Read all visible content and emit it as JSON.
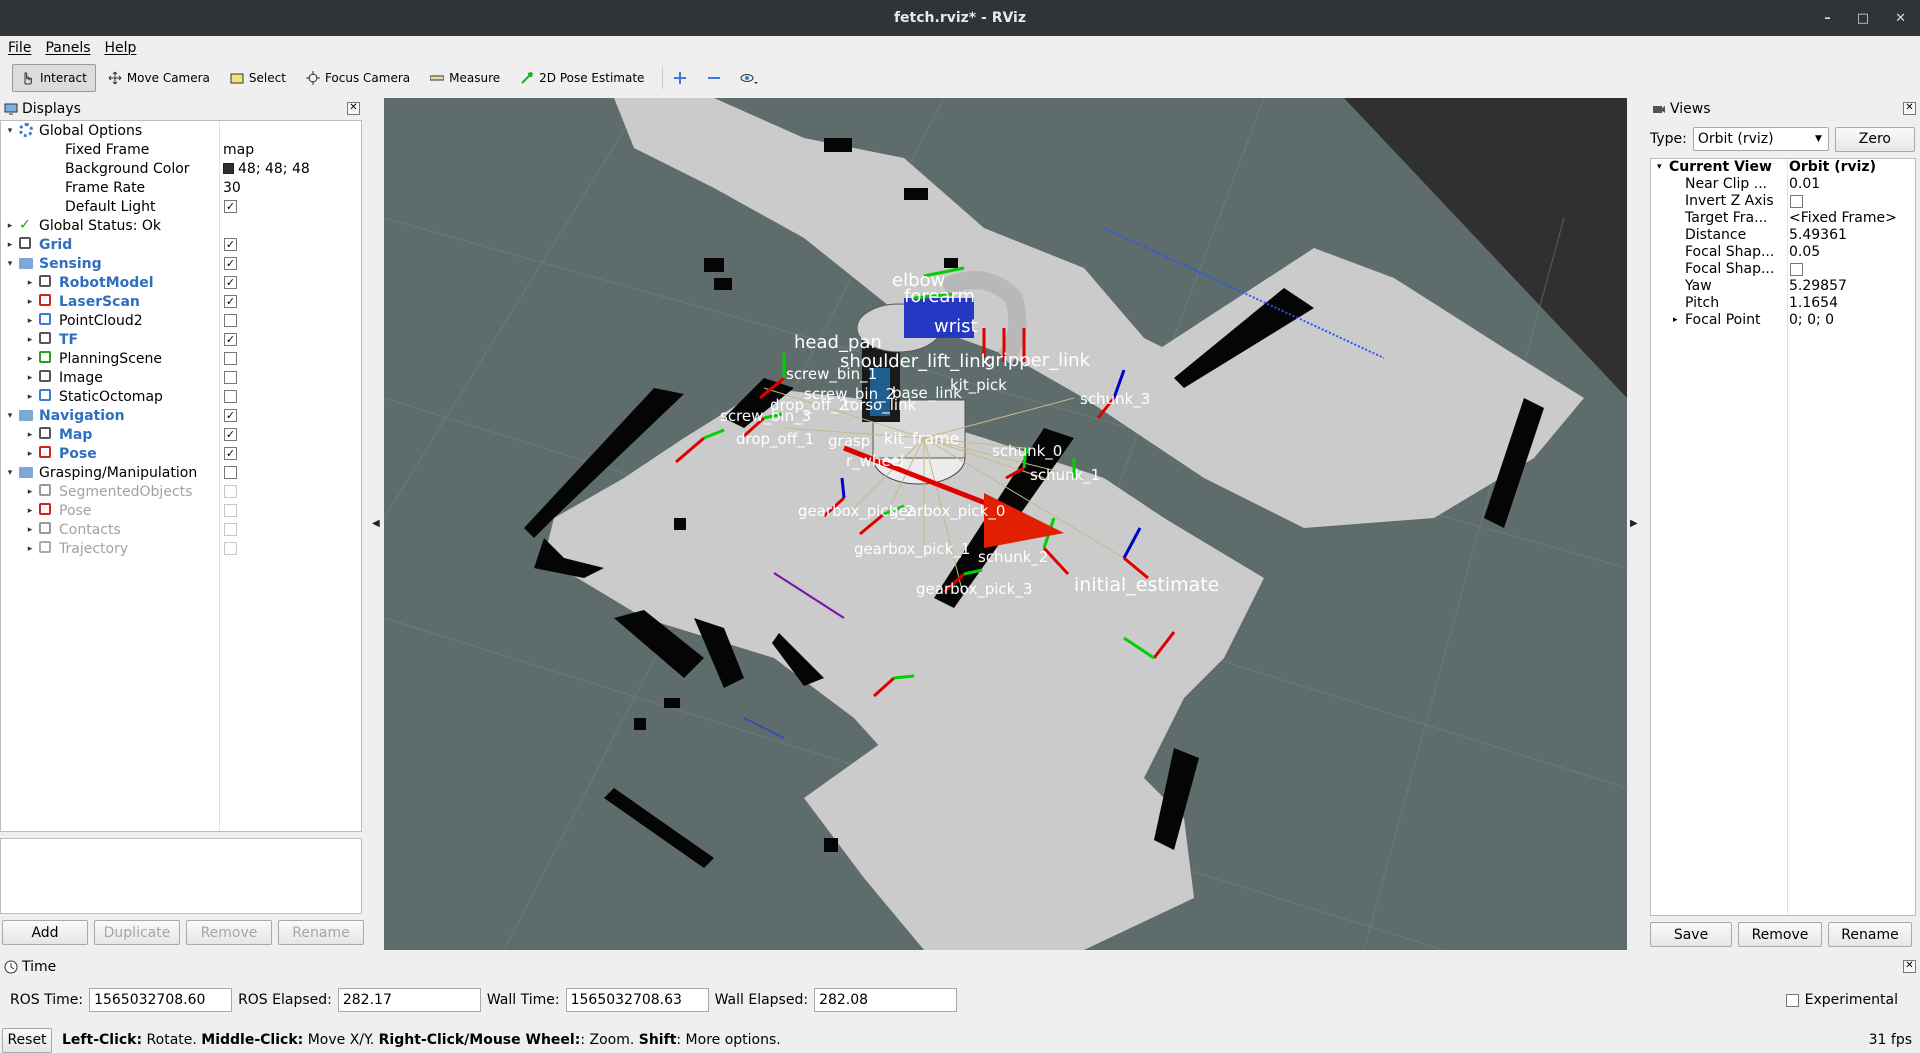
{
  "window": {
    "title": "fetch.rviz* - RViz",
    "controls": [
      "–",
      "□",
      "✕"
    ]
  },
  "menu": [
    "File",
    "Panels",
    "Help"
  ],
  "toolbar": {
    "tools": [
      {
        "label": "Interact",
        "icon": "hand-pointer-icon",
        "active": true
      },
      {
        "label": "Move Camera",
        "icon": "move-camera-icon"
      },
      {
        "label": "Select",
        "icon": "select-box-icon"
      },
      {
        "label": "Focus Camera",
        "icon": "focus-camera-icon"
      },
      {
        "label": "Measure",
        "icon": "ruler-icon"
      },
      {
        "label": "2D Pose Estimate",
        "icon": "pose-estimate-arrow-icon"
      }
    ],
    "extra_icons": [
      "plus-icon",
      "minus-icon",
      "eye-dropdown-icon"
    ]
  },
  "displays": {
    "title": "Displays",
    "rows": [
      {
        "label": "Global Options",
        "level": 0,
        "arrow": "▾",
        "icon": "gear-icon"
      },
      {
        "label": "Fixed Frame",
        "level": 1,
        "value": "map"
      },
      {
        "label": "Background Color",
        "level": 1,
        "value": "48; 48; 48",
        "swatch": "#303030"
      },
      {
        "label": "Frame Rate",
        "level": 1,
        "value": "30"
      },
      {
        "label": "Default Light",
        "level": 1,
        "check": true
      },
      {
        "label": "Global Status: Ok",
        "level": 0,
        "arrow": "▸",
        "icon": "check-icon"
      },
      {
        "label": "Grid",
        "level": 0,
        "arrow": "▸",
        "icon": "grid-icon",
        "blue": true,
        "check": true
      },
      {
        "label": "Sensing",
        "level": 0,
        "arrow": "▾",
        "icon": "folder-icon",
        "blue": true,
        "check": true
      },
      {
        "label": "RobotModel",
        "level": 1,
        "arrow": "▸",
        "icon": "robot-icon",
        "blue": true,
        "check": true
      },
      {
        "label": "LaserScan",
        "level": 1,
        "arrow": "▸",
        "icon": "laser-scan-icon",
        "blue": true,
        "check": true
      },
      {
        "label": "PointCloud2",
        "level": 1,
        "arrow": "▸",
        "icon": "point-cloud-icon",
        "check": false
      },
      {
        "label": "TF",
        "level": 1,
        "arrow": "▸",
        "icon": "tf-axes-icon",
        "blue": true,
        "check": true
      },
      {
        "label": "PlanningScene",
        "level": 1,
        "arrow": "▸",
        "icon": "planning-scene-icon",
        "check": false
      },
      {
        "label": "Image",
        "level": 1,
        "arrow": "▸",
        "icon": "image-icon",
        "check": false
      },
      {
        "label": "StaticOctomap",
        "level": 1,
        "arrow": "▸",
        "icon": "octomap-icon",
        "check": false
      },
      {
        "label": "Navigation",
        "level": 0,
        "arrow": "▾",
        "icon": "folder-icon",
        "blue": true,
        "check": true
      },
      {
        "label": "Map",
        "level": 1,
        "arrow": "▸",
        "icon": "map-icon",
        "blue": true,
        "check": true
      },
      {
        "label": "Pose",
        "level": 1,
        "arrow": "▸",
        "icon": "pose-arrow-icon",
        "blue": true,
        "check": true
      },
      {
        "label": "Grasping/Manipulation",
        "level": 0,
        "arrow": "▾",
        "icon": "folder-icon",
        "check": false
      },
      {
        "label": "SegmentedObjects",
        "level": 1,
        "arrow": "▸",
        "icon": "objects-icon",
        "grey": true,
        "check": false,
        "disabled": true
      },
      {
        "label": "Pose",
        "level": 1,
        "arrow": "▸",
        "icon": "pose-arrow-icon",
        "grey": true,
        "check": false,
        "disabled": true
      },
      {
        "label": "Contacts",
        "level": 1,
        "arrow": "▸",
        "icon": "contacts-icon",
        "grey": true,
        "check": false,
        "disabled": true
      },
      {
        "label": "Trajectory",
        "level": 1,
        "arrow": "▸",
        "icon": "trajectory-icon",
        "grey": true,
        "check": false,
        "disabled": true
      }
    ],
    "buttons": {
      "add": "Add",
      "duplicate": "Duplicate",
      "remove": "Remove",
      "rename": "Rename"
    }
  },
  "scene": {
    "labels": [
      "screw_bin_1",
      "screw_bin_2",
      "screw_bin_3",
      "drop_off_1",
      "drop_off_2",
      "kit_frame",
      "gearbox_pick_0",
      "gearbox_pick_1",
      "gearbox_pick_2",
      "gearbox_pick_3",
      "schunk_0",
      "schunk_1",
      "schunk_2",
      "schunk_3",
      "initial_estimate",
      "shoulder_lift_link",
      "elbow",
      "forearm",
      "wrist",
      "gripper_link",
      "head_pan",
      "torso_link",
      "r_wheel",
      "kit_pick",
      "grasp",
      "base_link"
    ],
    "colors": {
      "unknown": "#5e6c6c",
      "free": "#cbcbcb",
      "occupied": "#050505",
      "laser": "#2255ff",
      "tf_x": "#e00000",
      "tf_y": "#00d000",
      "tf_z": "#0000d0"
    }
  },
  "views": {
    "title": "Views",
    "type_label": "Type:",
    "type_value": "Orbit (rviz)",
    "zero_label": "Zero",
    "rows": [
      {
        "label": "Current View",
        "value": "Orbit (rviz)",
        "bold": true,
        "arrow": "▾",
        "level": 0
      },
      {
        "label": "Near Clip ...",
        "value": "0.01",
        "level": 1
      },
      {
        "label": "Invert Z Axis",
        "check": false,
        "level": 1
      },
      {
        "label": "Target Fra...",
        "value": "<Fixed Frame>",
        "level": 1
      },
      {
        "label": "Distance",
        "value": "5.49361",
        "level": 1
      },
      {
        "label": "Focal Shap...",
        "value": "0.05",
        "level": 1
      },
      {
        "label": "Focal Shap...",
        "check": false,
        "level": 1
      },
      {
        "label": "Yaw",
        "value": "5.29857",
        "level": 1
      },
      {
        "label": "Pitch",
        "value": "1.1654",
        "level": 1
      },
      {
        "label": "Focal Point",
        "value": "0; 0; 0",
        "level": 1,
        "arrow": "▸"
      }
    ],
    "buttons": {
      "save": "Save",
      "remove": "Remove",
      "rename": "Rename"
    }
  },
  "time": {
    "title": "Time",
    "ros_time_label": "ROS Time:",
    "ros_time": "1565032708.60",
    "ros_elapsed_label": "ROS Elapsed:",
    "ros_elapsed": "282.17",
    "wall_time_label": "Wall Time:",
    "wall_time": "1565032708.63",
    "wall_elapsed_label": "Wall Elapsed:",
    "wall_elapsed": "282.08",
    "experimental_label": "Experimental"
  },
  "status": {
    "reset_label": "Reset",
    "help": [
      {
        "bold": "Left-Click:",
        "text": " Rotate. "
      },
      {
        "bold": "Middle-Click:",
        "text": " Move X/Y. "
      },
      {
        "bold": "Right-Click/Mouse Wheel:",
        "text": ": Zoom. "
      },
      {
        "bold": "Shift",
        "text": ": More options."
      }
    ],
    "fps": "31 fps"
  }
}
